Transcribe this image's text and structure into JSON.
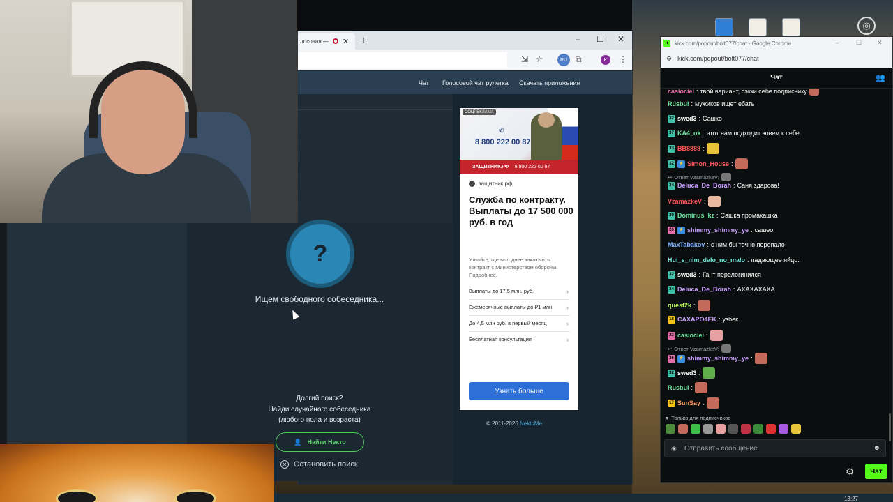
{
  "browser": {
    "tab_title": "лосовая —",
    "controls": {
      "minimize": "–",
      "maximize": "☐",
      "close": "✕"
    },
    "toolbar_badge": "RU",
    "avatar_letter": "K"
  },
  "site_nav": {
    "items": [
      {
        "label": "Чат"
      },
      {
        "label": "Голосовой чат рулетка"
      },
      {
        "label": "Скачать приложения"
      }
    ]
  },
  "ad": {
    "label": "СОЦРЕКЛАМА",
    "phone": "8 800 222 00 87",
    "bar_brand": "ЗАЩИТНИК.РФ",
    "bar_phone": "8 800 222 00 87",
    "domain": "защитник.рф",
    "headline": "Служба по контракту. Выплаты до 17 500 000 руб. в год",
    "description": "Узнайте, где выгоднее заключить контракт с Министерством обороны. Подробнее.",
    "items": [
      {
        "label": "Выплаты до 17,5 млн. руб."
      },
      {
        "label": "Ежемесячные выплаты до ₽1 млн"
      },
      {
        "label": "До 4,5 млн руб. в первый месяц"
      },
      {
        "label": "Бесплатная консультация"
      }
    ],
    "cta": "Узнать больше"
  },
  "footer": {
    "copyright": "© 2011-2026",
    "brand": "NektoMe"
  },
  "nekto": {
    "status": "Ищем свободного собеседника...",
    "long_search_line1": "Долгий поиск?",
    "long_search_line2": "Найди случайного собеседника",
    "long_search_line3": "(любого пола и возраста)",
    "find_button": "Найти Некто",
    "stop_button": "Остановить поиск"
  },
  "chat_window": {
    "window_title": "kick.com/popout/bolt077/chat - Google Chrome",
    "url": "kick.com/popout/bolt077/chat",
    "header": "Чат",
    "messages": [
      {
        "user": "casiociei",
        "text": "твой вариант, сэкки себе подписчику",
        "color": "#e36fa8"
      },
      {
        "user": "Rusbul",
        "text": "мужиков ищет ебать",
        "color": "#6fe3a0"
      },
      {
        "user": "swed3",
        "text": "Сашко",
        "color": "#ffffff",
        "badge": "32"
      },
      {
        "user": "KA4_ok",
        "text": "этот нам подходит зовем к себе",
        "color": "#6fe3a0",
        "badge": "37"
      },
      {
        "user": "BB8888",
        "text": "",
        "color": "#ff5a5a",
        "badge": "33"
      },
      {
        "user": "Simon_House",
        "text": "",
        "color": "#ff5a5a",
        "badge": "32"
      },
      {
        "reply": "Ответ VzamazkeV:"
      },
      {
        "user": "Deluca_De_Borah",
        "text": "Саня здарова!",
        "color": "#c9a0ff",
        "badge": "34"
      },
      {
        "user": "VzamazkeV",
        "text": "",
        "color": "#ff5a5a"
      },
      {
        "user": "Dominus_kz",
        "text": "Сашка промакашка",
        "color": "#6fe3a0",
        "badge": "30"
      },
      {
        "user": "shimmy_shimmy_ye",
        "text": "сашео",
        "color": "#c9a0ff",
        "badge": "26"
      },
      {
        "user": "MaxTabakov",
        "text": "с ним бы точно перепало",
        "color": "#7fb2ff"
      },
      {
        "user": "Hui_s_nim_dalo_no_malo",
        "text": "падающее яйцо.",
        "color": "#6fe3d6"
      },
      {
        "user": "swed3",
        "text": "Гант перелогинился",
        "color": "#ffffff",
        "badge": "32"
      },
      {
        "user": "Deluca_De_Borah",
        "text": "АХАХАХАХА",
        "color": "#c9a0ff",
        "badge": "34"
      },
      {
        "user": "quest2k",
        "text": "",
        "color": "#b5f55a"
      },
      {
        "user": "CAXAPO4EK",
        "text": "узбек",
        "color": "#c9a0ff",
        "badge": "18"
      },
      {
        "user": "casiociei",
        "text": "",
        "color": "#e36fa8",
        "badge": "23"
      },
      {
        "reply": "Ответ VzamazkeV:"
      },
      {
        "user": "shimmy_shimmy_ye",
        "text": "",
        "color": "#c9a0ff",
        "badge": "26"
      },
      {
        "user": "swed3",
        "text": "",
        "color": "#ffffff",
        "badge": "32"
      },
      {
        "user": "Rusbul",
        "text": "",
        "color": "#6fe3a0"
      },
      {
        "user": "SunSay",
        "text": "",
        "color": "#ff9a5a",
        "badge": "17"
      }
    ],
    "subs_only": "Только для подписчиков",
    "input_placeholder": "Отправить сообщение",
    "send_button": "Чат"
  },
  "taskbar": {
    "time": "13:27"
  }
}
